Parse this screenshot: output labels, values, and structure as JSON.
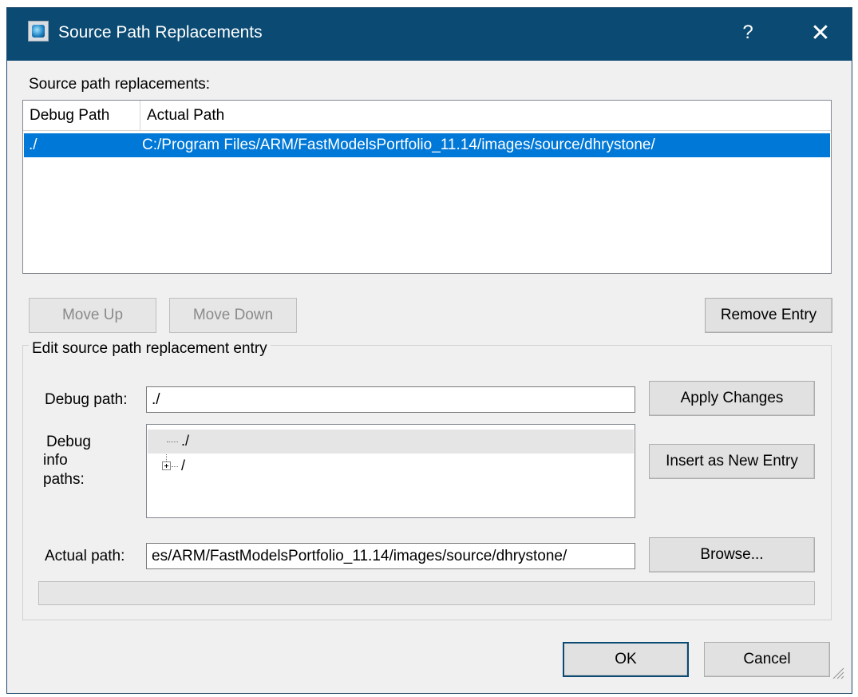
{
  "window": {
    "title": "Source Path Replacements",
    "help_glyph": "?",
    "close_glyph": "✕"
  },
  "list": {
    "label": "Source path replacements:",
    "columns": [
      "Debug Path",
      "Actual Path"
    ],
    "rows": [
      {
        "debug_path": "./",
        "actual_path": "C:/Program Files/ARM/FastModelsPortfolio_11.14/images/source/dhrystone/",
        "selected": true
      }
    ]
  },
  "buttons": {
    "move_up": "Move Up",
    "move_down": "Move Down",
    "remove_entry": "Remove Entry",
    "apply_changes": "Apply Changes",
    "insert_new": "Insert as New Entry",
    "browse": "Browse...",
    "ok": "OK",
    "cancel": "Cancel"
  },
  "edit_group": {
    "legend": "Edit source path replacement entry",
    "debug_path_label": "Debug path:",
    "debug_path_value": "./",
    "debug_info_label_line1": "Debug",
    "debug_info_label_line2": "info",
    "debug_info_label_line3": "paths:",
    "tree_items": [
      "./",
      "/"
    ],
    "actual_path_label": "Actual path:",
    "actual_path_value": "es/ARM/FastModelsPortfolio_11.14/images/source/dhrystone/"
  },
  "progress": {
    "value": 0
  },
  "colors": {
    "titlebar": "#0a4a73",
    "selection": "#0078d7",
    "dialog_bg": "#f0f0f0"
  }
}
